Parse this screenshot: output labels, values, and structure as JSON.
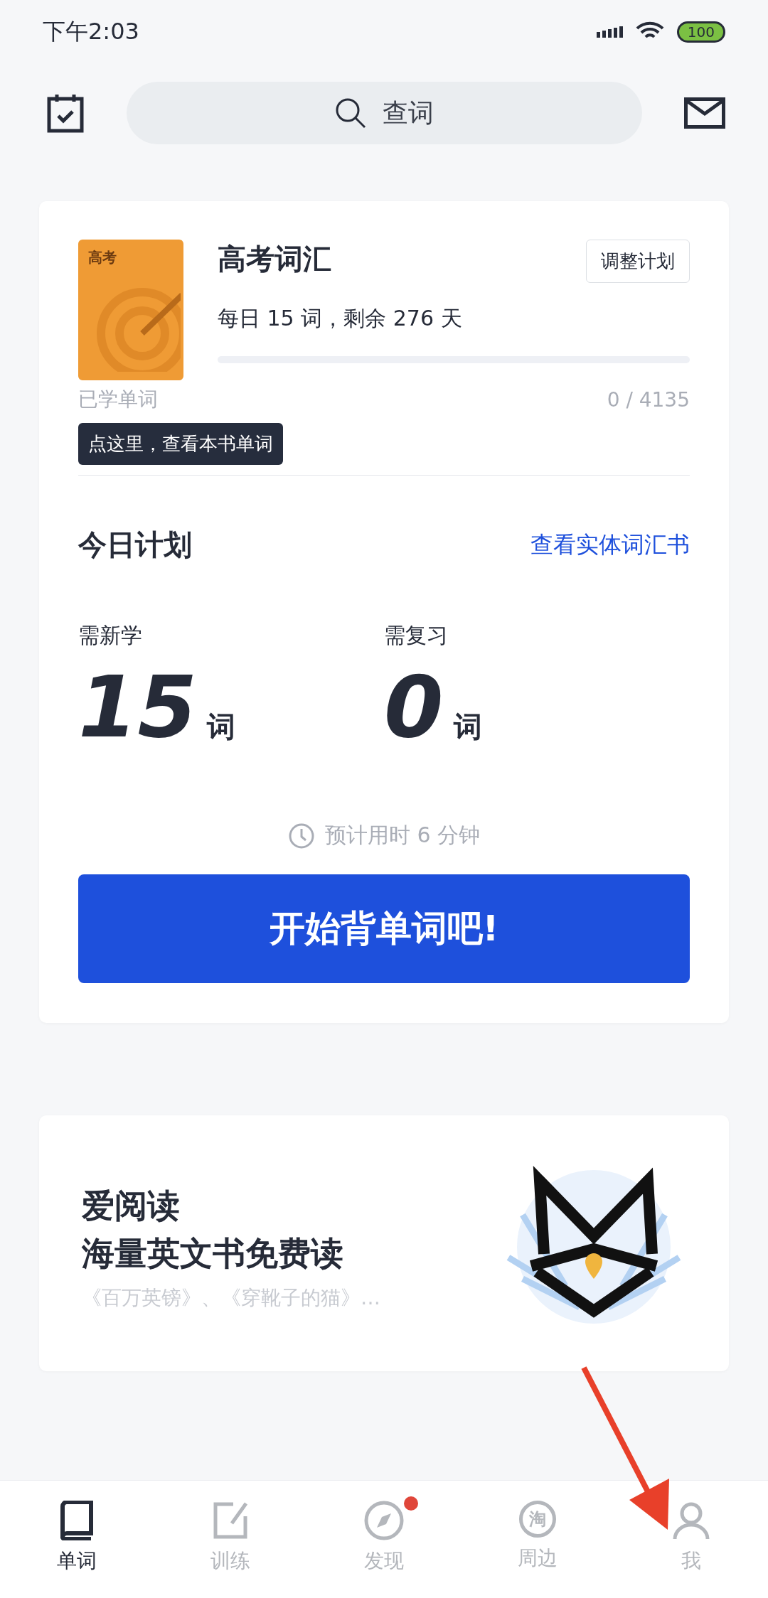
{
  "status_bar": {
    "time": "下午2:03",
    "battery": "100"
  },
  "search": {
    "placeholder": "查词"
  },
  "book": {
    "cover_label": "高考",
    "title": "高考词汇",
    "adjust_button": "调整计划",
    "schedule": "每日 15 词，剩余 276 天",
    "progress_label": "已学单词",
    "level": 0,
    "progress_count": "0 / 4135",
    "tooltip": "点这里，查看本书单词"
  },
  "plan": {
    "title": "今日计划",
    "link": "查看实体词汇书",
    "stats": [
      {
        "label": "需新学",
        "value": "15",
        "unit": "词"
      },
      {
        "label": "需复习",
        "value": "0",
        "unit": "词"
      }
    ],
    "estimate": "预计用时 6 分钟",
    "start_button": "开始背单词吧!"
  },
  "reading": {
    "title": "爱阅读",
    "subtitle": "海量英文书免费读",
    "books": "《百万英镑》、《穿靴子的猫》…"
  },
  "tabs": [
    {
      "label": "单词",
      "kind": "book",
      "selected": true,
      "badge": false
    },
    {
      "label": "训练",
      "kind": "edit",
      "selected": false,
      "badge": false
    },
    {
      "label": "发现",
      "kind": "compass",
      "selected": false,
      "badge": true
    },
    {
      "label": "周边",
      "kind": "shop",
      "icon_text": "淘",
      "selected": false,
      "badge": false
    },
    {
      "label": "我",
      "kind": "person",
      "selected": false,
      "badge": false
    }
  ],
  "annotation": {
    "kind": "arrow"
  }
}
